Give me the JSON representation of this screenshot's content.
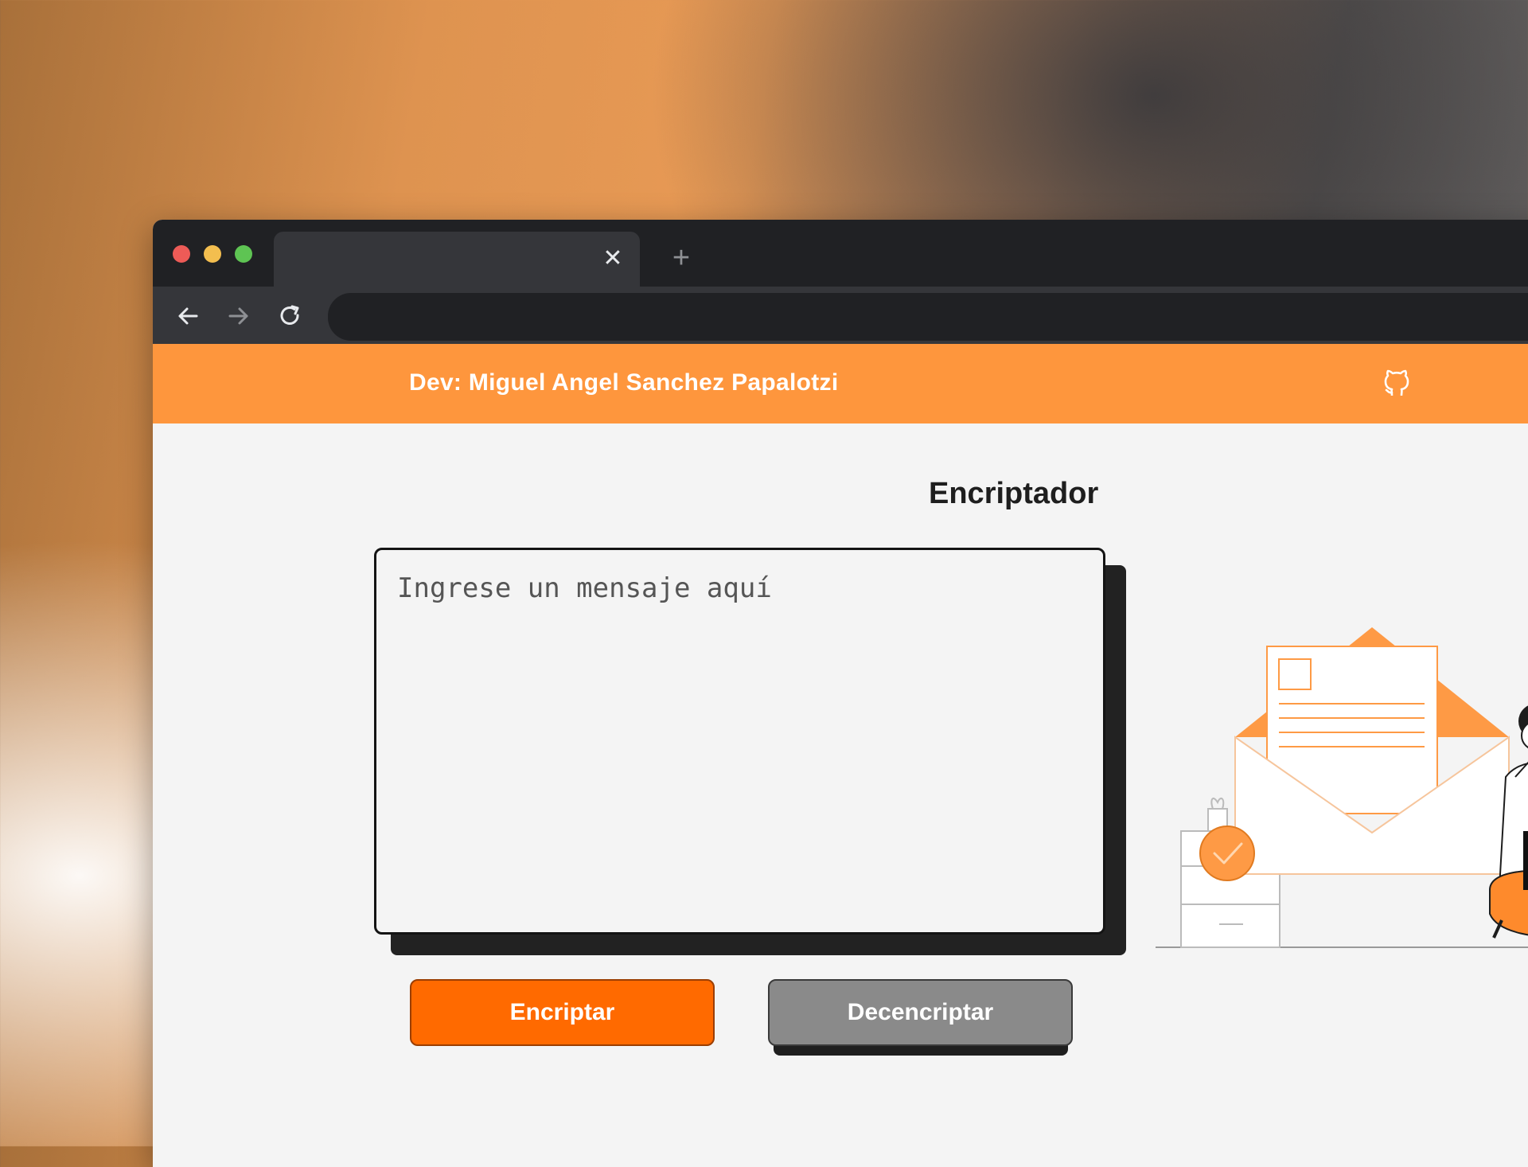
{
  "browser": {
    "tab": {
      "title": "",
      "close_glyph": "✕"
    },
    "new_tab_glyph": "+",
    "nav": {
      "back": "arrow-left-icon",
      "forward": "arrow-right-icon",
      "reload": "reload-icon"
    },
    "address": {
      "value": ""
    }
  },
  "header": {
    "dev_name": "Dev: Miguel Angel Sanchez Papalotzi",
    "github_icon": "github-icon"
  },
  "main": {
    "title": "Encriptador",
    "input": {
      "placeholder": "Ingrese un mensaje aquí",
      "value": ""
    },
    "buttons": {
      "encrypt": "Encriptar",
      "decrypt": "Decencriptar"
    }
  },
  "colors": {
    "header_bg": "#fe963d",
    "encrypt_bg": "#ff6a00",
    "decrypt_bg": "#8a8a8a",
    "page_bg": "#f4f4f4"
  }
}
